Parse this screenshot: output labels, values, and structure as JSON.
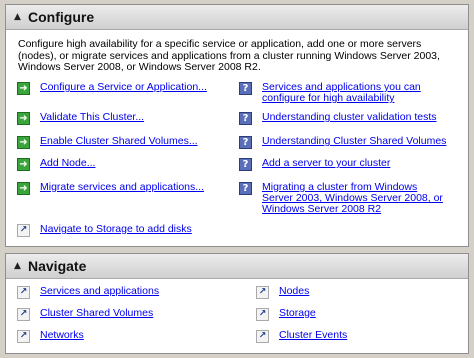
{
  "configure": {
    "title": "Configure",
    "description": "Configure high availability for a specific service or application, add one or more servers (nodes), or migrate services and applications from a cluster running Windows Server 2003, Windows Server 2008, or Windows Server 2008 R2.",
    "actions": [
      {
        "label": "Configure a Service or Application...",
        "icon": "green-arrow-icon"
      },
      {
        "label": "Validate This Cluster...",
        "icon": "green-arrow-icon"
      },
      {
        "label": "Enable Cluster Shared Volumes...",
        "icon": "green-arrow-icon"
      },
      {
        "label": "Add Node...",
        "icon": "green-arrow-icon"
      },
      {
        "label": "Migrate services and applications...",
        "icon": "green-arrow-icon"
      },
      {
        "label": "Navigate to Storage to add disks",
        "icon": "navigate-shortcut-icon"
      }
    ],
    "help_links": [
      {
        "label": "Services and applications you can configure for high availability",
        "icon": "help-icon"
      },
      {
        "label": "Understanding cluster validation tests",
        "icon": "help-icon"
      },
      {
        "label": "Understanding Cluster Shared Volumes",
        "icon": "help-icon"
      },
      {
        "label": "Add a server to your cluster",
        "icon": "help-icon"
      },
      {
        "label": "Migrating a cluster from Windows Server 2003, Windows Server 2008, or Windows Server 2008 R2",
        "icon": "help-icon"
      }
    ]
  },
  "navigate": {
    "title": "Navigate",
    "left": [
      "Services and applications",
      "Cluster Shared Volumes",
      "Networks"
    ],
    "right": [
      "Nodes",
      "Storage",
      "Cluster Events"
    ]
  },
  "colors": {
    "link": "#0000ee",
    "header_bg": "#dcdcdc",
    "window_bg": "#d4d0c8"
  }
}
